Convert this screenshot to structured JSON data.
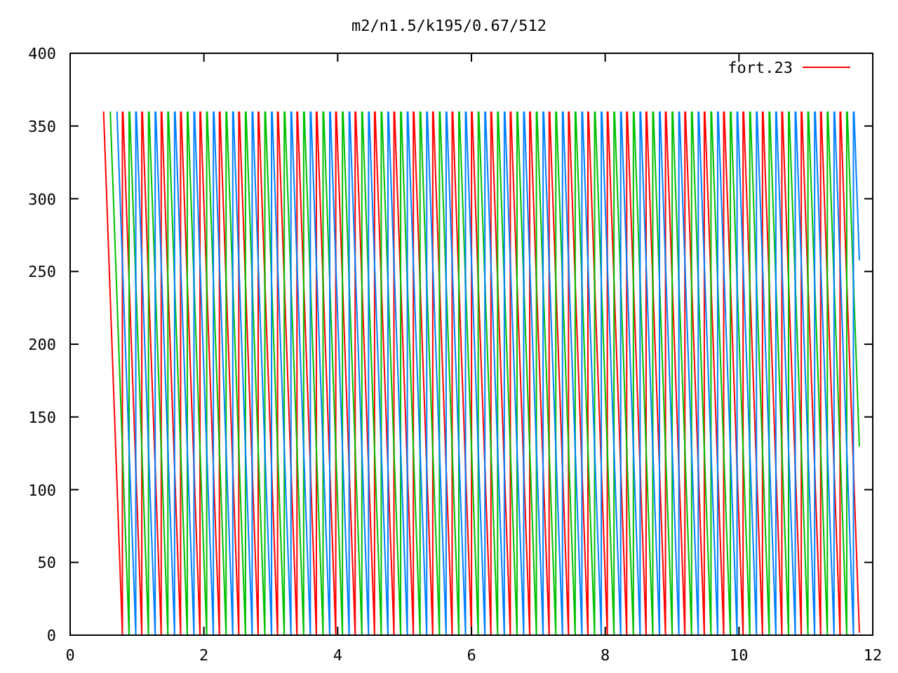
{
  "title": "m2/n1.5/k195/0.67/512",
  "y_tick_labels": [
    "400",
    "350",
    "300",
    "250",
    "200",
    "150",
    "100",
    "50",
    "0"
  ],
  "x_tick_labels": [
    "0",
    "2",
    "4",
    "6",
    "8",
    "10",
    "12"
  ],
  "legend": [
    {
      "label": "fort.23",
      "color": "#ff0000"
    }
  ]
}
